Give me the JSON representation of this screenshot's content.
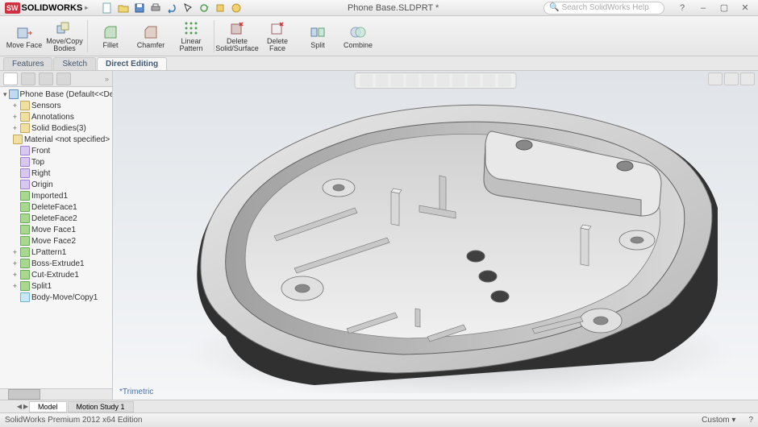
{
  "titlebar": {
    "app": "SOLIDWORKS",
    "doc": "Phone Base.SLDPRT *",
    "search_placeholder": "Search SolidWorks Help"
  },
  "ribbon": {
    "tools": [
      {
        "label": "Move\nFace",
        "icon": "move-face"
      },
      {
        "label": "Move/Copy\nBodies",
        "icon": "move-copy"
      },
      {
        "label": "Fillet",
        "icon": "fillet"
      },
      {
        "label": "Chamfer",
        "icon": "chamfer"
      },
      {
        "label": "Linear\nPattern",
        "icon": "pattern"
      },
      {
        "label": "Delete\nSolid/Surface",
        "icon": "delete-solid"
      },
      {
        "label": "Delete\nFace",
        "icon": "delete-face"
      },
      {
        "label": "Split",
        "icon": "split"
      },
      {
        "label": "Combine",
        "icon": "combine"
      }
    ]
  },
  "tabs": {
    "items": [
      "Features",
      "Sketch",
      "Direct Editing"
    ],
    "active": 2
  },
  "tree": {
    "root": "Phone Base  (Default<<Default>",
    "nodes": [
      {
        "label": "Sensors",
        "cls": "folder"
      },
      {
        "label": "Annotations",
        "cls": "folder"
      },
      {
        "label": "Solid Bodies(3)",
        "cls": "folder"
      },
      {
        "label": "Material <not specified>",
        "cls": "folder"
      },
      {
        "label": "Front",
        "cls": "plane"
      },
      {
        "label": "Top",
        "cls": "plane"
      },
      {
        "label": "Right",
        "cls": "plane"
      },
      {
        "label": "Origin",
        "cls": "plane"
      },
      {
        "label": "Imported1",
        "cls": "feat"
      },
      {
        "label": "DeleteFace1",
        "cls": "feat"
      },
      {
        "label": "DeleteFace2",
        "cls": "feat"
      },
      {
        "label": "Move Face1",
        "cls": "feat"
      },
      {
        "label": "Move Face2",
        "cls": "feat"
      },
      {
        "label": "LPattern1",
        "cls": "feat"
      },
      {
        "label": "Boss-Extrude1",
        "cls": "feat"
      },
      {
        "label": "Cut-Extrude1",
        "cls": "feat"
      },
      {
        "label": "Split1",
        "cls": "feat"
      },
      {
        "label": "Body-Move/Copy1",
        "cls": "body"
      }
    ]
  },
  "viewport": {
    "mode": "*Trimetric"
  },
  "bottom_tabs": {
    "items": [
      "Model",
      "Motion Study 1"
    ],
    "active": 0
  },
  "status": {
    "left": "SolidWorks Premium 2012 x64 Edition",
    "custom": "Custom  ▾"
  }
}
